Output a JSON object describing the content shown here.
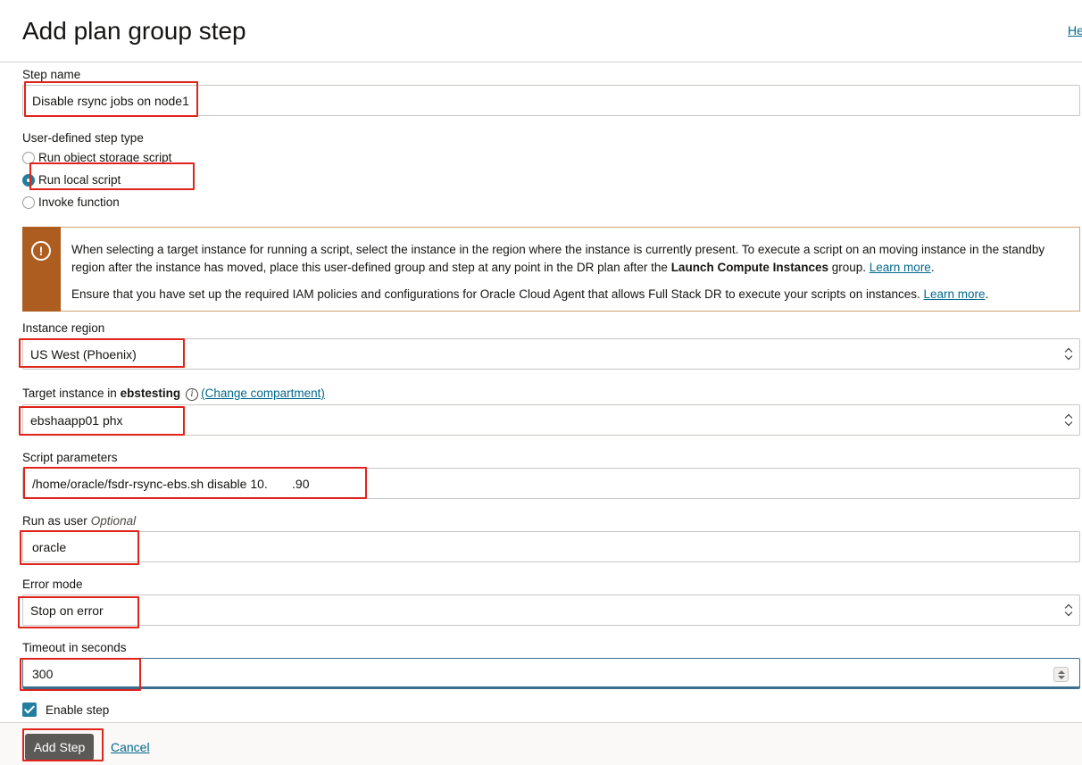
{
  "page": {
    "title": "Add plan group step",
    "help_label": "He"
  },
  "form": {
    "step_name": {
      "label": "Step name",
      "value": "Disable rsync jobs on node1"
    },
    "step_type": {
      "label": "User-defined step type",
      "options": [
        "Run object storage script",
        "Run local script",
        "Invoke function"
      ],
      "selected": "Run local script"
    },
    "alert": {
      "icon": "warning-icon",
      "para1_text": "When selecting a target instance for running a script, select the instance in the region where the instance is currently present. To execute a script on an moving instance in the standby region after the instance has moved, place this user-defined group and step at any point in the DR plan after the",
      "para1_bold": "Launch Compute Instances",
      "para1_after": "group.",
      "para1_link": "Learn more",
      "para2_text": "Ensure that you have set up the required IAM policies and configurations for Oracle Cloud Agent that allows Full Stack DR to execute your scripts on instances.",
      "para2_link": "Learn more"
    },
    "instance_region": {
      "label": "Instance region",
      "value": "US West (Phoenix)"
    },
    "target_instance": {
      "label_prefix": "Target instance in",
      "compartment": "ebstesting",
      "change_link": "(Change compartment)",
      "value": "ebshaapp01 phx"
    },
    "script_parameters": {
      "label": "Script parameters",
      "value": "/home/oracle/fsdr-rsync-ebs.sh disable 10.       .90"
    },
    "run_as_user": {
      "label": "Run as user",
      "optional_label": "Optional",
      "value": "oracle"
    },
    "error_mode": {
      "label": "Error mode",
      "value": "Stop on error"
    },
    "timeout": {
      "label": "Timeout in seconds",
      "value": "300"
    },
    "enable_step": {
      "label": "Enable step",
      "checked": true
    }
  },
  "footer": {
    "primary_label": "Add Step",
    "cancel_label": "Cancel"
  },
  "colors": {
    "accent": "#227e9e",
    "link": "#00688c",
    "warning": "#ad5d20",
    "highlight": "#e0231b",
    "primary_button": "#5c5a57"
  }
}
